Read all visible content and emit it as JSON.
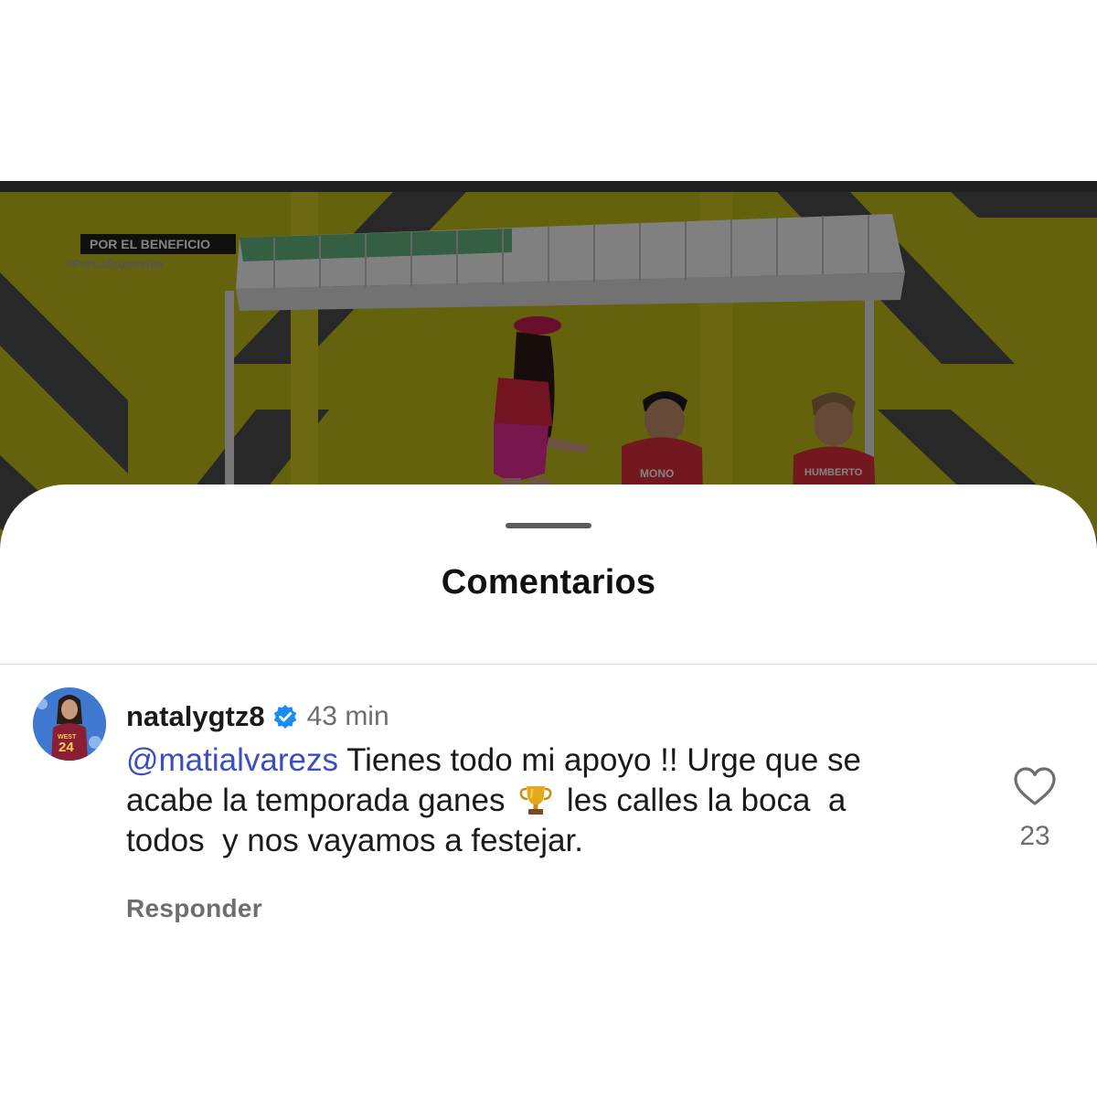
{
  "video": {
    "overlay_line1": "POR EL BENEFICIO",
    "overlay_line2": "#PorLaSupervive",
    "jersey_left": "MONO",
    "jersey_right": "HUMBERTO"
  },
  "sheet": {
    "title": "Comentarios"
  },
  "comment": {
    "username": "natalygtz8",
    "verified": true,
    "timestamp": "43 min",
    "mention": "@matialvarezs",
    "line1_text": " Tienes todo mi apoyo !! Urge que se",
    "line2_before": "acabe la temporada ganes ",
    "line2_after": " les calles la boca  a",
    "line3": "todos  y nos vayamos a festejar.",
    "reply_label": "Responder",
    "like_count": "23",
    "avatar_jersey_text": "WEST",
    "avatar_jersey_number": "24"
  },
  "colors": {
    "mention": "#3b4dbf",
    "verified_badge": "#1d8cf0",
    "secondary_text": "#6e6e6e",
    "video_background": "#a8a21a"
  },
  "icons": [
    "verified-badge-icon",
    "trophy-icon",
    "heart-icon"
  ]
}
